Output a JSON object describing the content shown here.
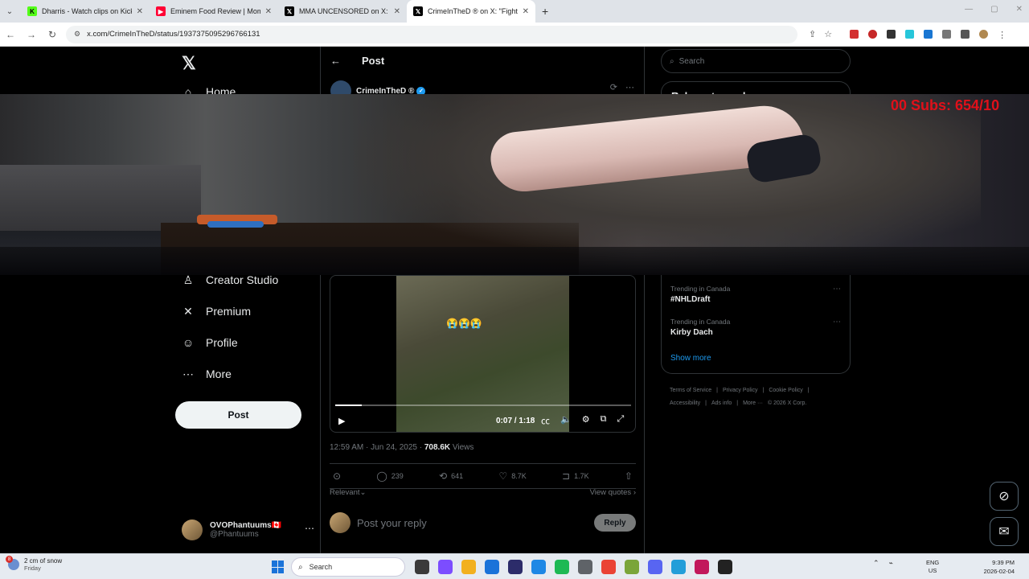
{
  "browser": {
    "tabs": [
      {
        "title": "Dharris - Watch clips on Kick",
        "color": "#53fc18",
        "glyph": "K"
      },
      {
        "title": "Eminem Food Review | Mom's spa",
        "color": "#ff0033",
        "glyph": "▶"
      },
      {
        "title": "MMA UNCENSORED on X: \"Sha",
        "color": "#000000",
        "glyph": "𝕏"
      },
      {
        "title": "CrimeInTheD ® on X: \"Fights ca",
        "color": "#000000",
        "glyph": "𝕏"
      }
    ],
    "url": "x.com/CrimeInTheD/status/1937375095296766131"
  },
  "nav": {
    "items": [
      {
        "label": "Home",
        "icon": "home-icon",
        "glyph": "⌂"
      },
      {
        "label": "Creator Studio",
        "icon": "creator-studio-icon",
        "glyph": "♙"
      },
      {
        "label": "Premium",
        "icon": "x-premium-icon",
        "glyph": "✕"
      },
      {
        "label": "Profile",
        "icon": "profile-icon",
        "glyph": "☺"
      },
      {
        "label": "More",
        "icon": "more-circle-icon",
        "glyph": "⋯"
      }
    ],
    "post_button": "Post",
    "account": {
      "name": "OVOPhantuums🇨🇦",
      "handle": "@Phantuums"
    }
  },
  "post": {
    "header_title": "Post",
    "author_name": "CrimeInTheD ®",
    "video": {
      "time": "0:07 / 1:18",
      "progress": 0.09,
      "emoji": "😭😭😭"
    },
    "timestamp": "12:59 AM · Jun 24, 2025 · ",
    "views_count": "708.6K",
    "views_label": " Views",
    "counts": {
      "replies": "239",
      "reposts": "641",
      "likes": "8.7K",
      "bookmarks": "1.7K"
    },
    "sort_label": "Relevant",
    "view_quotes": "View quotes",
    "reply_placeholder": "Post your reply",
    "reply_button": "Reply"
  },
  "sidebar": {
    "search_placeholder": "Search",
    "relevant_title": "Relevant people",
    "trends": [
      {
        "context": "Trending in Canada",
        "name": "#NHLDraft"
      },
      {
        "context": "Trending in Canada",
        "name": "Kirby Dach"
      }
    ],
    "show_more": "Show more",
    "footer": [
      "Terms of Service",
      "|",
      "Privacy Policy",
      "|",
      "Cookie Policy",
      "|",
      "Accessibility",
      "|",
      "Ads info",
      "|",
      "More ···",
      "© 2026 X Corp."
    ]
  },
  "overlay": {
    "subs_text": "00  Subs: 654/10"
  },
  "taskbar": {
    "weather": "2 cm of snow",
    "weather_sub": "Friday",
    "weather_badge": "8",
    "search": "Search",
    "lang1": "ENG",
    "lang2": "US",
    "time": "9:39 PM",
    "date": "2026-02-04",
    "app_colors": [
      "#3a3a3a",
      "#7c4dff",
      "#f2b01e",
      "#1a73d9",
      "#2c2c6a",
      "#1e88e5",
      "#1db954",
      "#5f6368",
      "#ea4335",
      "#7aa53a",
      "#5865f2",
      "#229ed9",
      "#c2185b",
      "#222222"
    ]
  }
}
